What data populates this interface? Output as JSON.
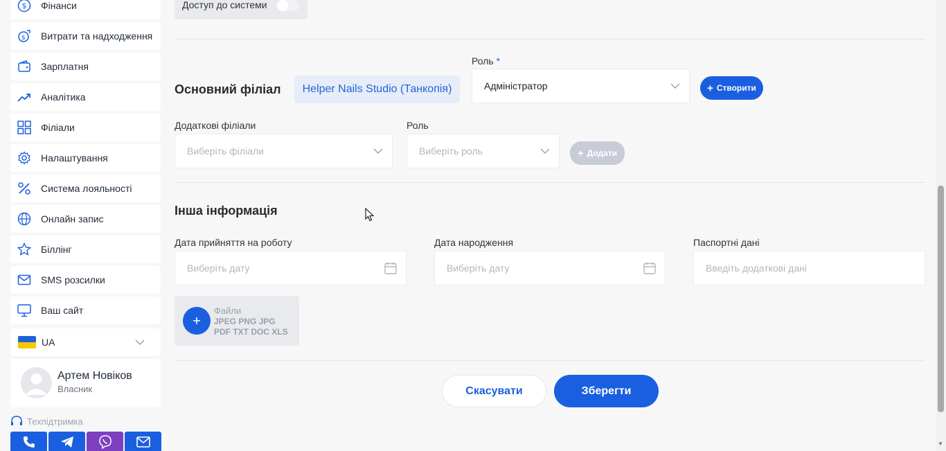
{
  "sidebar": {
    "items": [
      {
        "label": "Фінанси",
        "icon": "dollar-circle-icon"
      },
      {
        "label": "Витрати та надходження",
        "icon": "coins-icon"
      },
      {
        "label": "Зарплатня",
        "icon": "wallet-icon"
      },
      {
        "label": "Аналітика",
        "icon": "trend-up-icon"
      },
      {
        "label": "Філіали",
        "icon": "grid-icon"
      },
      {
        "label": "Налаштування",
        "icon": "gear-icon"
      },
      {
        "label": "Система лояльності",
        "icon": "percent-icon"
      },
      {
        "label": "Онлайн запис",
        "icon": "globe-icon"
      },
      {
        "label": "Біллінг",
        "icon": "star-icon"
      },
      {
        "label": "SMS розсилки",
        "icon": "mail-icon"
      },
      {
        "label": "Ваш сайт",
        "icon": "monitor-icon"
      }
    ],
    "language": "UA",
    "user": {
      "name": "Артем Новіков",
      "role": "Власник"
    },
    "support": "Техпідтримка",
    "contacts": [
      {
        "icon": "phone-icon",
        "color": "#1a5fe0"
      },
      {
        "icon": "telegram-icon",
        "color": "#1a5fe0"
      },
      {
        "icon": "viber-icon",
        "color": "#7b3fbf"
      },
      {
        "icon": "mail-icon",
        "color": "#1a5fe0"
      }
    ]
  },
  "form": {
    "access_label": "Доступ до системи",
    "access_enabled": false,
    "main_branch_title": "Основний філіал",
    "main_branch_name": "Helper Nails Studio (Танкопія)",
    "role_label": "Роль",
    "role_required_mark": "*",
    "role_value": "Адміністратор",
    "create_button": "Створити",
    "extra_branches_label": "Додаткові філіали",
    "extra_branches_placeholder": "Виберіть філіали",
    "extra_role_label": "Роль",
    "extra_role_placeholder": "Виберіть роль",
    "add_button": "Додати",
    "other_info_title": "Інша інформація",
    "hire_date_label": "Дата прийняття на роботу",
    "hire_date_placeholder": "Виберіть дату",
    "birth_date_label": "Дата народження",
    "birth_date_placeholder": "Виберіть дату",
    "passport_label": "Паспортні дані",
    "passport_placeholder": "Введіть додаткові дані",
    "files_title": "Файли",
    "files_formats": "JPEG PNG JPG PDF TXT DOC XLS",
    "cancel_button": "Скасувати",
    "save_button": "Зберегти"
  },
  "colors": {
    "accent": "#1a5fe0",
    "disabled": "#c7ccd6",
    "chip_bg": "#e6edf8"
  }
}
